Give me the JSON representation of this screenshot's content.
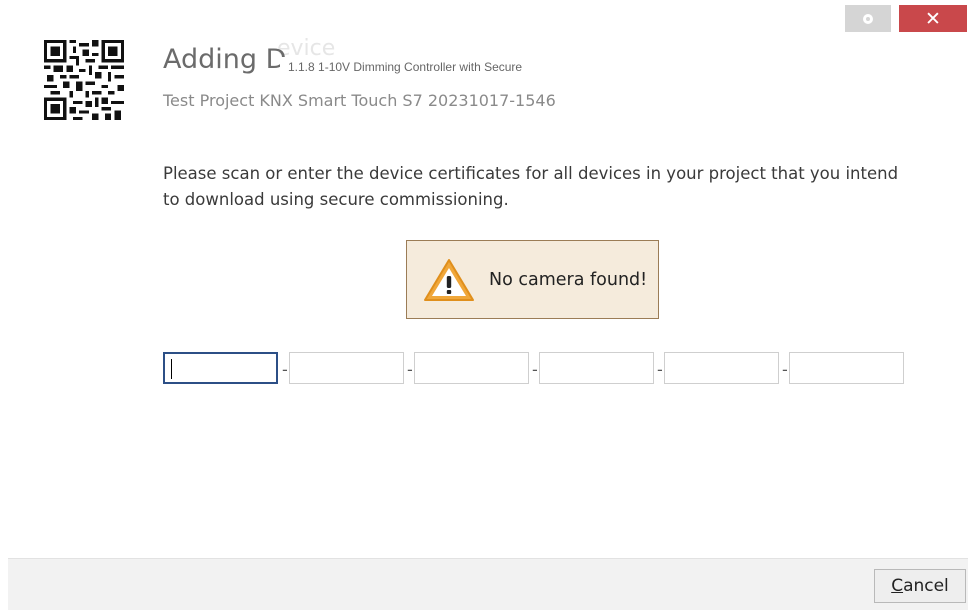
{
  "window": {
    "settings_icon": "gear-icon",
    "close_icon": "close-icon",
    "close_glyph": "✕",
    "close_color": "#c9484b"
  },
  "header": {
    "title": "Adding D",
    "title_faded": "evice",
    "device_tooltip": "1.1.8 1-10V Dimming Controller with Secure",
    "subtitle": "Test Project KNX Smart Touch S7 20231017-1546"
  },
  "body": {
    "instructions": "Please scan or enter the device certificates for all devices in your project that you intend to download using secure commissioning."
  },
  "warning": {
    "icon": "warning-icon",
    "message": "No camera found!",
    "background": "#f5ebdc"
  },
  "certificate": {
    "fields": [
      "",
      "",
      "",
      "",
      "",
      ""
    ],
    "separator": "-"
  },
  "footer": {
    "cancel_mnemonic": "C",
    "cancel_rest": "ancel"
  }
}
